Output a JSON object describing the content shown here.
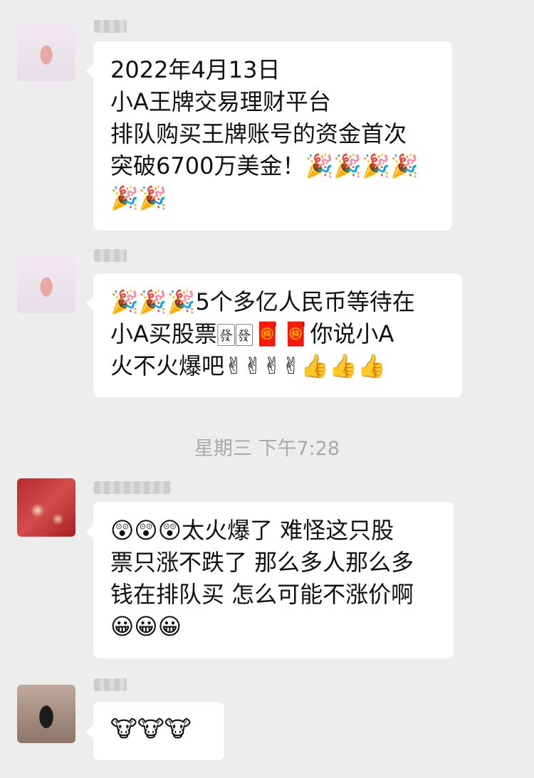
{
  "messages": [
    {
      "nickname": "",
      "text": "2022年4月13日\n小A王牌交易理财平台\n排队购买王牌账号的资金首次\n突破6700万美金！🎉🎉🎉🎉\n🎉🎉"
    },
    {
      "nickname": "",
      "text": "🎉🎉🎉5个多亿人民币等待在\n小A买股票🀅🀅🧧🧧你说小A\n火不火爆吧✌✌✌✌👍👍👍"
    },
    {
      "nickname": "",
      "text": "😲😲😲太火爆了 难怪这只股\n票只涨不跌了 那么多人那么多\n钱在排队买 怎么可能不涨价啊\n😀😀😀"
    },
    {
      "nickname": "",
      "text": "🐮🐮🐮"
    }
  ],
  "timestamp": "星期三 下午7:28"
}
